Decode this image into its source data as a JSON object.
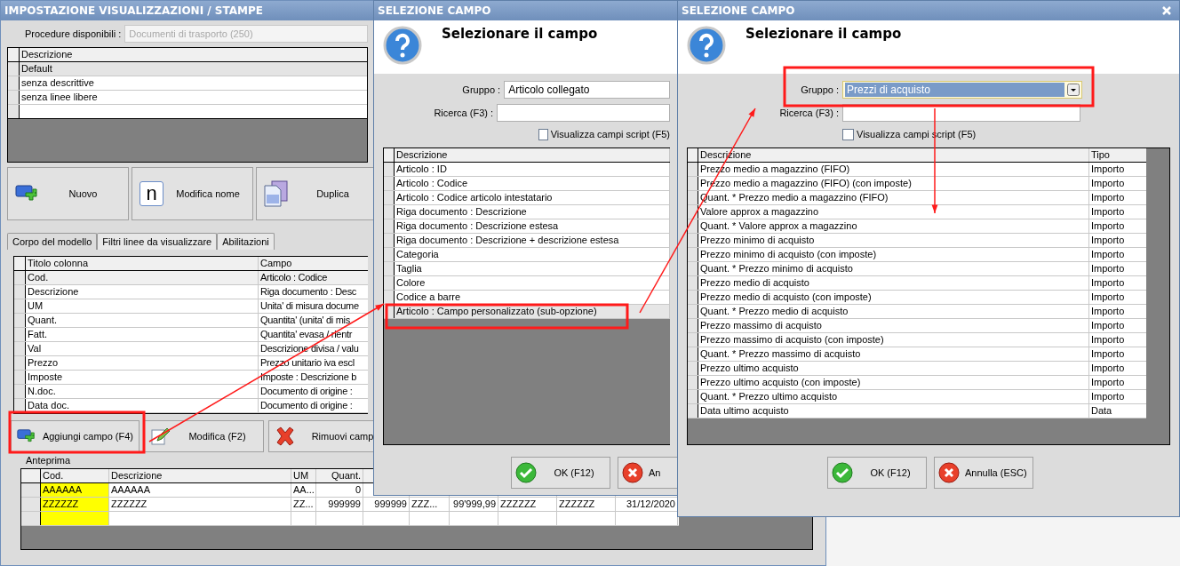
{
  "main_window": {
    "title": "IMPOSTAZIONE VISUALIZZAZIONI / STAMPE",
    "procedure_label": "Procedure disponibili :",
    "procedure_value": "Documenti di trasporto (250)",
    "models_table": {
      "column": "Descrizione",
      "rows": [
        {
          "text": "Default",
          "selected": true
        },
        {
          "text": "senza descrittive",
          "selected": false
        },
        {
          "text": "senza linee libere",
          "selected": false
        }
      ]
    },
    "model_buttons": [
      {
        "kind": "new",
        "label": "Nuovo"
      },
      {
        "kind": "rename",
        "icon_text": "n",
        "label": "Modifica nome"
      },
      {
        "kind": "duplicate",
        "label": "Duplica"
      }
    ],
    "tabs": [
      {
        "label": "Corpo del modello",
        "selected": true
      },
      {
        "label": "Filtri linee da visualizzare",
        "selected": false
      },
      {
        "label": "Abilitazioni",
        "selected": false
      }
    ],
    "columns_table": {
      "columns": [
        "Titolo colonna",
        "Campo"
      ],
      "rows": [
        {
          "cells": [
            "Cod.",
            "Articolo : Codice"
          ],
          "selected": true
        },
        {
          "cells": [
            "Descrizione",
            "Riga documento : Desc"
          ],
          "selected": false
        },
        {
          "cells": [
            "UM",
            "Unita' di misura docume"
          ],
          "selected": false
        },
        {
          "cells": [
            "Quant.",
            "Quantita' (unita' di mis"
          ],
          "selected": false
        },
        {
          "cells": [
            "Fatt.",
            "Quantita' evasa / rientr"
          ],
          "selected": false
        },
        {
          "cells": [
            "Val",
            "Descrizione divisa / valu"
          ],
          "selected": false
        },
        {
          "cells": [
            "Prezzo",
            "Prezzo unitario iva escl"
          ],
          "selected": false
        },
        {
          "cells": [
            "Imposte",
            "Imposte : Descrizione b"
          ],
          "selected": false
        },
        {
          "cells": [
            "N.doc.",
            "Documento di origine :"
          ],
          "selected": false
        },
        {
          "cells": [
            "Data doc.",
            "Documento di origine :"
          ],
          "selected": false
        }
      ]
    },
    "field_buttons": [
      {
        "kind": "add",
        "label": "Aggiungi campo (F4)"
      },
      {
        "kind": "edit",
        "label": "Modifica (F2)"
      },
      {
        "kind": "remove",
        "label": "Rimuovi camp"
      }
    ],
    "preview": {
      "label": "Anteprima",
      "columns": [
        "Cod.",
        "Descrizione",
        "UM",
        "Quant."
      ],
      "rows": [
        [
          "AAAAAA",
          "AAAAAA",
          "AA...",
          "0"
        ],
        [
          "ZZZZZZ",
          "ZZZZZZ",
          "ZZ...",
          "999999",
          "999999",
          "ZZZ...",
          "99'999,99",
          "ZZZZZZ",
          "ZZZZZZ",
          "31/12/2020"
        ]
      ]
    }
  },
  "dialogs": [
    {
      "title": "SELEZIONE CAMPO",
      "heading": "Selezionare il campo",
      "group_label": "Gruppo :",
      "group_value": "Articolo collegato",
      "group_highlighted": false,
      "search_label": "Ricerca (F3) :",
      "checkbox_label": "Visualizza campi script (F5)",
      "checked": false,
      "closable": false,
      "columns": [
        "Descrizione"
      ],
      "rows": [
        {
          "description": "Articolo : ID",
          "selected": false
        },
        {
          "description": "Articolo : Codice",
          "selected": false
        },
        {
          "description": "Articolo : Codice articolo intestatario",
          "selected": false
        },
        {
          "description": "Riga documento : Descrizione",
          "selected": false
        },
        {
          "description": "Riga documento : Descrizione estesa",
          "selected": false
        },
        {
          "description": "Riga documento : Descrizione + descrizione estesa",
          "selected": false
        },
        {
          "description": "Categoria",
          "selected": false
        },
        {
          "description": "Taglia",
          "selected": false
        },
        {
          "description": "Colore",
          "selected": false
        },
        {
          "description": "Codice a barre",
          "selected": false
        },
        {
          "description": "Articolo : Campo personalizzato (sub-opzione)",
          "selected": true
        }
      ],
      "buttons": [
        {
          "kind": "ok",
          "label": "OK (F12)"
        },
        {
          "kind": "cancel",
          "label": "An"
        }
      ]
    },
    {
      "title": "SELEZIONE CAMPO",
      "heading": "Selezionare il campo",
      "group_label": "Gruppo :",
      "group_value": "Prezzi di acquisto",
      "group_highlighted": true,
      "search_label": "Ricerca (F3) :",
      "checkbox_label": "Visualizza campi script (F5)",
      "checked": false,
      "closable": true,
      "columns": [
        "Descrizione",
        "Tipo"
      ],
      "rows": [
        {
          "description": "Prezzo medio a magazzino (FIFO)",
          "type": "Importo",
          "selected": false
        },
        {
          "description": "Prezzo medio a magazzino (FIFO) (con imposte)",
          "type": "Importo",
          "selected": false
        },
        {
          "description": "Quant. * Prezzo medio a magazzino (FIFO)",
          "type": "Importo",
          "selected": false
        },
        {
          "description": "Valore approx a magazzino",
          "type": "Importo",
          "selected": false
        },
        {
          "description": "Quant. * Valore approx a magazzino",
          "type": "Importo",
          "selected": false
        },
        {
          "description": "Prezzo minimo di acquisto",
          "type": "Importo",
          "selected": false
        },
        {
          "description": "Prezzo minimo di acquisto (con imposte)",
          "type": "Importo",
          "selected": false
        },
        {
          "description": "Quant. * Prezzo minimo di acquisto",
          "type": "Importo",
          "selected": false
        },
        {
          "description": "Prezzo medio di acquisto",
          "type": "Importo",
          "selected": false
        },
        {
          "description": "Prezzo medio di acquisto (con imposte)",
          "type": "Importo",
          "selected": false
        },
        {
          "description": "Quant. * Prezzo medio di acquisto",
          "type": "Importo",
          "selected": false
        },
        {
          "description": "Prezzo massimo di acquisto",
          "type": "Importo",
          "selected": false
        },
        {
          "description": "Prezzo massimo di acquisto (con imposte)",
          "type": "Importo",
          "selected": false
        },
        {
          "description": "Quant. * Prezzo massimo di acquisto",
          "type": "Importo",
          "selected": false
        },
        {
          "description": "Prezzo ultimo acquisto",
          "type": "Importo",
          "selected": false
        },
        {
          "description": "Prezzo ultimo acquisto (con imposte)",
          "type": "Importo",
          "selected": false
        },
        {
          "description": "Quant. * Prezzo ultimo acquisto",
          "type": "Importo",
          "selected": false
        },
        {
          "description": "Data ultimo acquisto",
          "type": "Data",
          "selected": false
        }
      ],
      "buttons": [
        {
          "kind": "ok",
          "label": "OK (F12)"
        },
        {
          "kind": "cancel",
          "label": "Annulla (ESC)"
        }
      ]
    }
  ]
}
